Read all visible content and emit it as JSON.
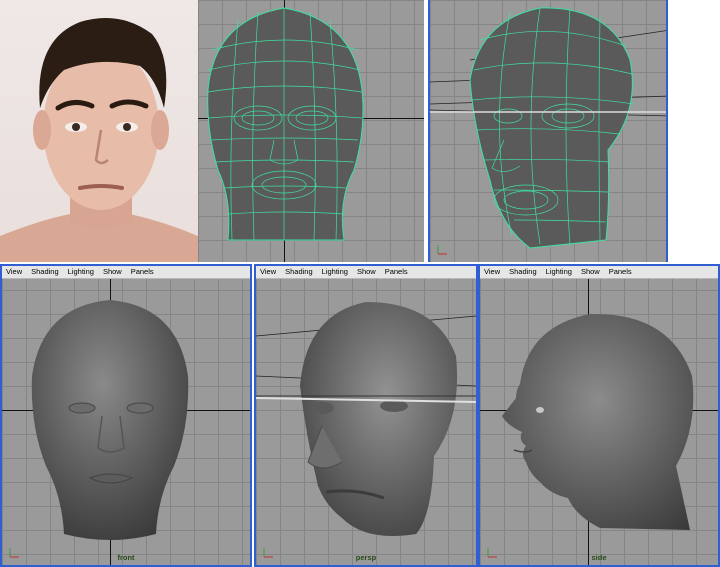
{
  "viewports": [
    {
      "id": "front",
      "label": "front",
      "menu": [
        "View",
        "Shading",
        "Lighting",
        "Show",
        "Panels"
      ]
    },
    {
      "id": "persp",
      "label": "persp",
      "menu": [
        "View",
        "Shading",
        "Lighting",
        "Show",
        "Panels"
      ]
    },
    {
      "id": "side",
      "label": "side",
      "menu": [
        "View",
        "Shading",
        "Lighting",
        "Show",
        "Panels"
      ]
    }
  ],
  "colors": {
    "viewport_bg": "#9a9a9a",
    "grid_line": "#858585",
    "wireframe": "#3fe0a0",
    "active_frame": "#2f5fd0",
    "skin": "#e8c2b2"
  },
  "icons": {
    "axis_gizmo": "axis-gizmo-icon"
  }
}
